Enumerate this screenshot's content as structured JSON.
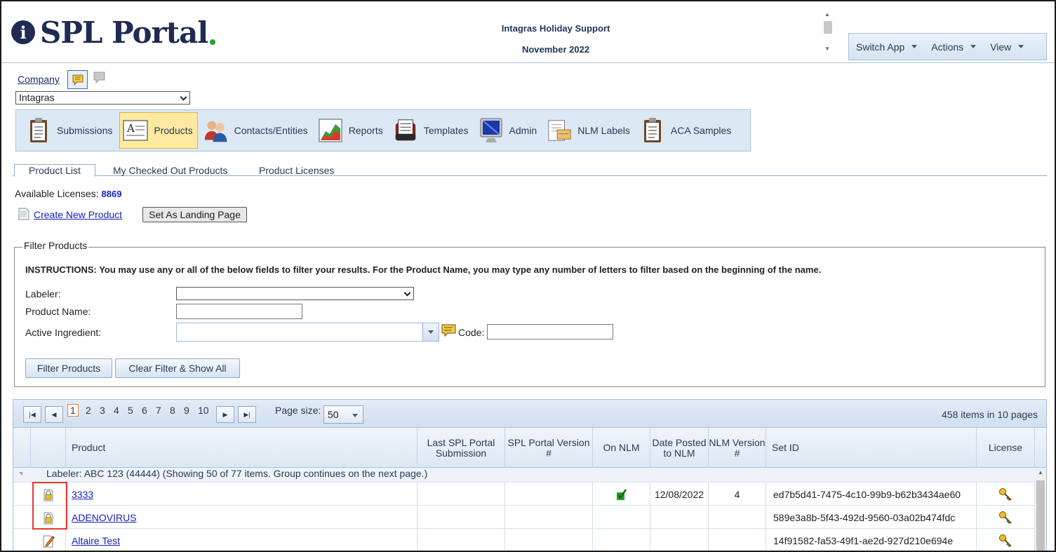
{
  "header": {
    "announcement_line1": "Intagras Holiday Support",
    "announcement_line2": "November 2022",
    "logo_text": "SPL Portal",
    "logo_icon": "i",
    "brand_color": "#1f2b52",
    "accent_color": "#19a733"
  },
  "app_menu": {
    "switch_app": "Switch App",
    "actions": "Actions",
    "view": "View"
  },
  "company": {
    "label": "Company",
    "selected": "Intagras"
  },
  "modules": [
    {
      "label": "Submissions",
      "icon": "clipboard-icon"
    },
    {
      "label": "Products",
      "icon": "product-icon",
      "active": true
    },
    {
      "label": "Contacts/Entities",
      "icon": "people-icon"
    },
    {
      "label": "Reports",
      "icon": "chart-icon"
    },
    {
      "label": "Templates",
      "icon": "template-icon"
    },
    {
      "label": "Admin",
      "icon": "monitor-icon"
    },
    {
      "label": "NLM Labels",
      "icon": "label-icon"
    },
    {
      "label": "ACA Samples",
      "icon": "clipboard-icon"
    }
  ],
  "tabs": [
    "Product List",
    "My Checked Out Products",
    "Product Licenses"
  ],
  "licenses": {
    "label": "Available Licenses:",
    "count": "8869"
  },
  "actions": {
    "create_product": "Create New Product",
    "set_landing": "Set As Landing Page"
  },
  "filter": {
    "legend": "Filter Products",
    "instructions": "INSTRUCTIONS: You may use any or all of the below fields to filter your results. For the Product Name, you may type any number of letters to filter based on the beginning of the name.",
    "labeler_label": "Labeler:",
    "labeler_value": "",
    "product_name_label": "Product Name:",
    "product_name_value": "",
    "active_ingredient_label": "Active Ingredient:",
    "active_ingredient_value": "",
    "code_label": "Code:",
    "code_value": "",
    "filter_button": "Filter Products",
    "clear_button": "Clear Filter & Show All"
  },
  "pager": {
    "pages": [
      "1",
      "2",
      "3",
      "4",
      "5",
      "6",
      "7",
      "8",
      "9",
      "10"
    ],
    "current_page": "1",
    "page_size_label": "Page size:",
    "page_size": "50",
    "items_info": "458 items in 10 pages"
  },
  "columns": {
    "product": "Product",
    "last_submission": "Last SPL Portal Submission",
    "version": "SPL Portal Version #",
    "on_nlm": "On NLM",
    "date_posted": "Date Posted to NLM",
    "nlm_version": "NLM Version #",
    "set_id": "Set ID",
    "license": "License"
  },
  "group_label": "Labeler: ABC 123 (44444) (Showing 50 of 77 items. Group continues on the next page.)",
  "rows": [
    {
      "product": "3333",
      "status_icon": "locked-icon",
      "on_nlm": true,
      "date_posted": "12/08/2022",
      "nlm_version": "4",
      "set_id": "ed7b5d41-7475-4c10-99b9-b62b3434ae60"
    },
    {
      "product": "ADENOVIRUS",
      "status_icon": "locked-icon",
      "on_nlm": false,
      "date_posted": "",
      "nlm_version": "",
      "set_id": "589e3a8b-5f43-492d-9560-03a02b474fdc"
    },
    {
      "product": "Altaire Test",
      "status_icon": "edit-icon",
      "on_nlm": false,
      "date_posted": "",
      "nlm_version": "",
      "set_id": "14f91582-fa53-49f1-ae2d-927d210e694e"
    }
  ]
}
